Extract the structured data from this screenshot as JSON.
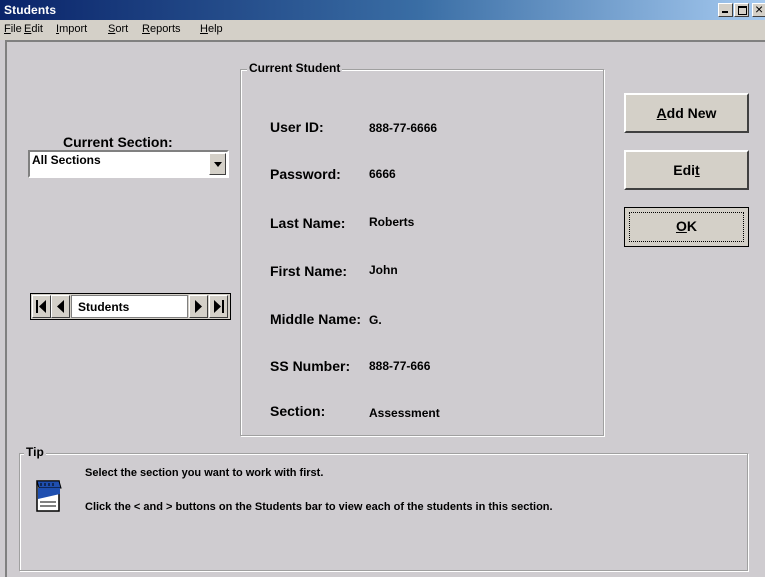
{
  "window": {
    "title": "Students"
  },
  "menu": [
    {
      "key": "F",
      "rest": "ile"
    },
    {
      "key": "E",
      "rest": "dit"
    },
    {
      "key": "I",
      "rest": "mport"
    },
    {
      "key": "S",
      "rest": "ort"
    },
    {
      "key": "R",
      "rest": "eports"
    },
    {
      "key": "H",
      "rest": "elp"
    }
  ],
  "section": {
    "label": "Current Section:",
    "selected": "All Sections"
  },
  "navigator": {
    "label": "Students"
  },
  "student": {
    "group_title": "Current Student",
    "fields": [
      {
        "label": "User ID:",
        "value": "888-77-6666"
      },
      {
        "label": "Password:",
        "value": "6666"
      },
      {
        "label": "Last Name:",
        "value": "Roberts"
      },
      {
        "label": "First Name:",
        "value": "John"
      },
      {
        "label": "Middle Name:",
        "value": "G."
      },
      {
        "label": "SS Number:",
        "value": "888-77-666"
      },
      {
        "label": "Section:",
        "value": "Assessment"
      }
    ]
  },
  "buttons": {
    "add_new": {
      "key": "A",
      "rest": "dd New"
    },
    "edit": {
      "pre": "Edi",
      "key": "t"
    },
    "ok": {
      "key": "O",
      "rest": "K"
    }
  },
  "tip": {
    "title": "Tip",
    "line1": "Select the section you want to work with first.",
    "line2": "Click the < and > buttons on the Students bar to view each of the students in this section."
  },
  "icons": [
    "minimize-icon",
    "maximize-icon",
    "close-icon",
    "dropdown-arrow-icon",
    "first-record-icon",
    "previous-record-icon",
    "next-record-icon",
    "last-record-icon",
    "notepad-icon"
  ],
  "colors": {
    "titlebar": "#0a246a",
    "face": "#cfccd0",
    "button": "#d4d0c8"
  }
}
